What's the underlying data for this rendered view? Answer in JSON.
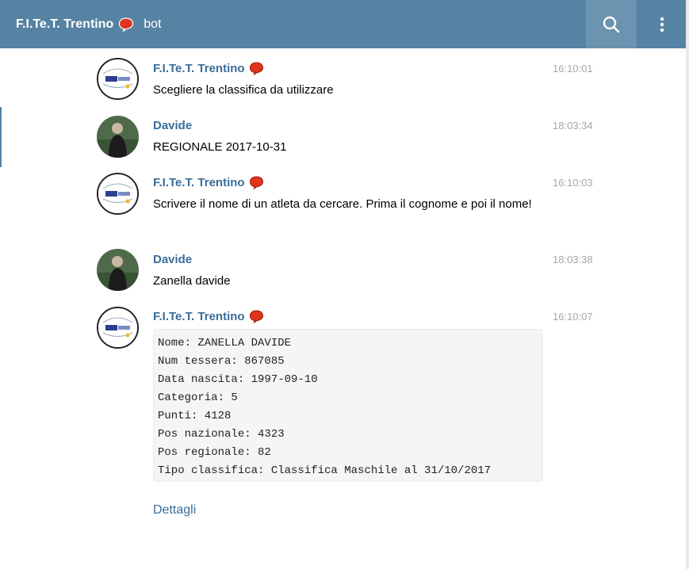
{
  "header": {
    "chat_name": "F.I.Te.T. Trentino",
    "chat_type": "bot",
    "search_icon": "search-icon",
    "menu_icon": "more-vertical-icon"
  },
  "messages": [
    {
      "author": "F.I.Te.T. Trentino",
      "time": "16:10:01",
      "text": "Scegliere la classifica da utilizzare",
      "avatar": "fitet-logo"
    },
    {
      "author": "Davide",
      "time": "18:03:34",
      "text": "REGIONALE 2017-10-31",
      "avatar": "user-photo"
    },
    {
      "author": "F.I.Te.T. Trentino",
      "time": "16:10:03",
      "text": "Scrivere il nome di un atleta da cercare. Prima il cognome e poi il nome!",
      "avatar": "fitet-logo"
    },
    {
      "author": "Davide",
      "time": "18:03:38",
      "text": "Zanella davide",
      "avatar": "user-photo"
    },
    {
      "author": "F.I.Te.T. Trentino",
      "time": "16:10:07",
      "avatar": "fitet-logo",
      "pre_lines": [
        "Nome: ZANELLA DAVIDE",
        "Num tessera: 867085",
        "Data nascita: 1997-09-10",
        "Categoria: 5",
        "Punti: 4128",
        "Pos nazionale: 4323",
        "Pos regionale: 82",
        "Tipo classifica: Classifica Maschile al 31/10/2017"
      ]
    }
  ],
  "details_link": "Dettagli",
  "colors": {
    "header_bg": "#5682a3",
    "author": "#3a6d99",
    "time": "#a7a7a7",
    "bot_badge": "#e0341c"
  }
}
